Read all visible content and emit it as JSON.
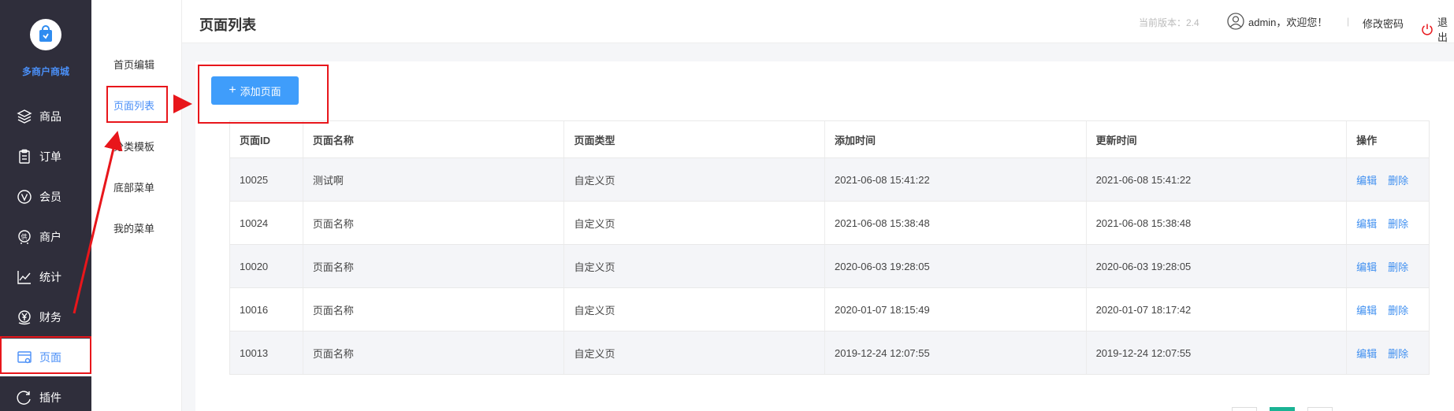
{
  "app": {
    "name": "多商户商城"
  },
  "sidebar": {
    "items": [
      {
        "label": "商品",
        "icon": "layers-icon"
      },
      {
        "label": "订单",
        "icon": "clipboard-icon"
      },
      {
        "label": "会员",
        "icon": "member-v-icon"
      },
      {
        "label": "商户",
        "icon": "merchant-icon"
      },
      {
        "label": "统计",
        "icon": "chart-line-icon"
      },
      {
        "label": "财务",
        "icon": "yen-icon"
      },
      {
        "label": "页面",
        "icon": "page-icon",
        "active": true
      },
      {
        "label": "插件",
        "icon": "plugin-icon"
      }
    ]
  },
  "submenu": {
    "items": [
      {
        "label": "首页编辑"
      },
      {
        "label": "页面列表",
        "active": true
      },
      {
        "label": "分类模板"
      },
      {
        "label": "底部菜单"
      },
      {
        "label": "我的菜单"
      }
    ]
  },
  "header": {
    "title": "页面列表",
    "version": "当前版本：2.4",
    "user": "admin，欢迎您！",
    "divider": "|",
    "change_password": "修改密码",
    "logout": "退出"
  },
  "toolbar": {
    "add_page_label": "添加页面"
  },
  "table": {
    "columns": [
      "页面ID",
      "页面名称",
      "页面类型",
      "添加时间",
      "更新时间",
      "操作"
    ],
    "rows": [
      {
        "id": "10025",
        "name": "测试啊",
        "type": "自定义页",
        "created": "2021-06-08 15:41:22",
        "updated": "2021-06-08 15:41:22"
      },
      {
        "id": "10024",
        "name": "页面名称",
        "type": "自定义页",
        "created": "2021-06-08 15:38:48",
        "updated": "2021-06-08 15:38:48"
      },
      {
        "id": "10020",
        "name": "页面名称",
        "type": "自定义页",
        "created": "2020-06-03 19:28:05",
        "updated": "2020-06-03 19:28:05"
      },
      {
        "id": "10016",
        "name": "页面名称",
        "type": "自定义页",
        "created": "2020-01-07 18:15:49",
        "updated": "2020-01-07 18:17:42"
      },
      {
        "id": "10013",
        "name": "页面名称",
        "type": "自定义页",
        "created": "2019-12-24 12:07:55",
        "updated": "2019-12-24 12:07:55"
      }
    ],
    "actions": {
      "edit": "编辑",
      "delete": "删除"
    }
  },
  "colors": {
    "accent": "#3f9dfb",
    "sidebar_bg": "#2f2e3b",
    "annotation": "#e8161b"
  }
}
